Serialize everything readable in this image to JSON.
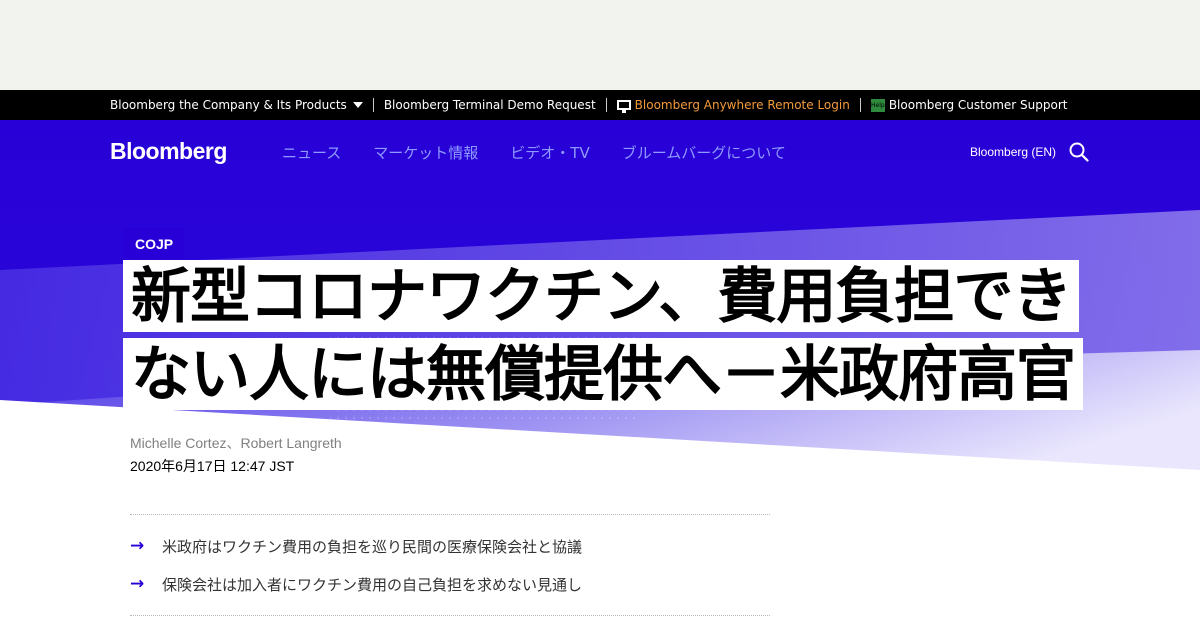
{
  "top_strip": {
    "company_label": "Bloomberg the Company & Its Products",
    "terminal_demo": "Bloomberg Terminal Demo Request",
    "anywhere_login": "Bloomberg Anywhere Remote Login",
    "help_icon_label": "Help",
    "customer_support": "Bloomberg Customer Support"
  },
  "nav": {
    "logo": "Bloomberg",
    "links": [
      "ニュース",
      "マーケット情報",
      "ビデオ・TV",
      "ブルームバーグについて"
    ],
    "region": "Bloomberg (EN)"
  },
  "article": {
    "section": "COJP",
    "headline": "新型コロナワクチン、費用負担できない人には無償提供へ－米政府高官",
    "authors": "Michelle Cortez、Robert Langreth",
    "date": "2020年6月17日 12:47 JST",
    "abstract": [
      "米政府はワクチン費用の負担を巡り民間の医療保険会社と協議",
      "保険会社は加入者にワクチン費用の自己負担を求めない見通し"
    ]
  },
  "colors": {
    "brand_blue": "#2800d7",
    "nav_link": "#8f9bff",
    "orange_link": "#f39a3b",
    "help_green": "#2e8b3d"
  },
  "icons": [
    "caret-down-icon",
    "monitor-icon",
    "help-icon",
    "search-icon",
    "arrow-right-icon"
  ]
}
